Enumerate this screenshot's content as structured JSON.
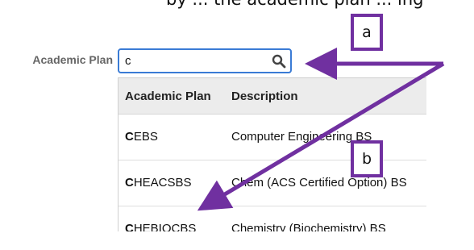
{
  "top_text_fragment": "by ... the academic plan ... ing",
  "form": {
    "label": "Academic Plan",
    "search_value": "c",
    "search_icon": "search-icon"
  },
  "dropdown": {
    "columns": [
      "Academic Plan",
      "Description"
    ],
    "rows": [
      {
        "match": "C",
        "code_rest": "EBS",
        "description": "Computer Engineering BS"
      },
      {
        "match": "C",
        "code_rest": "HEACSBS",
        "description": "Chem (ACS Certified Option) BS"
      },
      {
        "match": "C",
        "code_rest": "HEBIOCBS",
        "description": "Chemistry (Biochemistry) BS"
      }
    ]
  },
  "callouts": {
    "a": "a",
    "b": "b"
  },
  "colors": {
    "accent_purple": "#7030a0",
    "focus_blue": "#3a7bd5"
  }
}
